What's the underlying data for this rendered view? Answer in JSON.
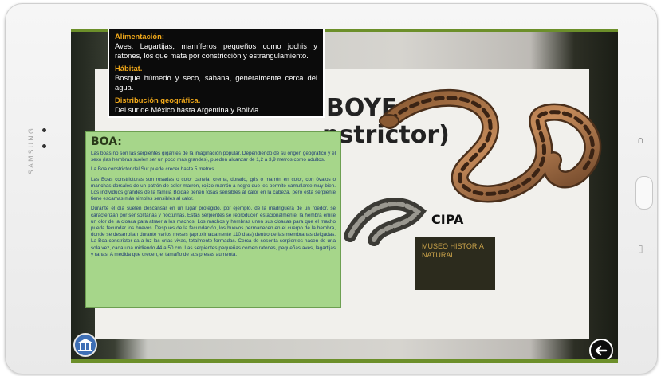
{
  "device": {
    "brand": "SAMSUNG"
  },
  "info_top": {
    "alimentacion_heading": "Alimentación:",
    "alimentacion_text": "Aves, Lagartijas, mamíferos pequeños como jochis y ratones, los que mata por constricción y estrangulamiento.",
    "habitat_heading": "Hábitat.",
    "habitat_text": "Bosque húmedo y seco, sabana, generalmente cerca del agua.",
    "distribucion_heading": "Distribución geográfica.",
    "distribucion_text": "Del sur de México hasta Argentina y Bolivia."
  },
  "boa_panel": {
    "title": "BOA:",
    "paragraphs": [
      "Las boas no son las serpientes gigantes de la imaginación popular. Dependiendo de su origen geográfico y el sexo (las hembras suelen ser un poco más grandes), pueden alcanzar de 1,2 a 3,9 metros como adultos.",
      "La Boa constrictor del Sur puede crecer hasta 5 metros.",
      "Las Boas constrictoras son rosadas o color canela, crema, dorado, gris o marrón en color, con óvalos o manchas dorsales de un patrón de color marrón, rojizo-marrón a negro que les permite camuflarse muy bien. Los individuos grandes de la familia Boidae tienen fosas sensibles al calor en la cabeza, pero esta serpiente tiene escamas más simples sensibles al calor.",
      "Durante el día suelen descansar en un lugar protegido, por ejemplo, de la madriguera de un roedor, se caracterizan por ser solitarias y nocturnas. Estas serpientes se reproducen estacionalmente; la hembra emite un olor de la cloaca para atraer a los machos. Los machos y hembras unen sus cloacas para que el macho pueda fecundar los huevos. Después de la fecundación, los huevos permanecen en el cuerpo de la hembra, donde se desarrollan durante varios meses (aproximadamente 110 días) dentro de las membranas delgadas. La Boa constrictor da a luz las crías vivas, totalmente formadas. Cerca de sesenta serpientes nacen de una sola vez, cada una midiendo 44 a 50 cm. Las serpientes pequeñas comen ratones, pequeñas aves, lagartijas y ranas. A medida que crecen, el tamaño de sus presas aumenta."
    ]
  },
  "poster": {
    "title_fragment": "BOYE",
    "subtitle_fragment": "nstrictor)",
    "logo_text": "CIPA",
    "museum_text": "MUSEO HISTORIA NATURAL"
  },
  "icons": {
    "museum": "museum-icon",
    "back": "back-arrow-icon"
  },
  "colors": {
    "panel_green": "#a6d68a",
    "heading_orange": "#f0a81a",
    "frame_green": "#6c8f2a"
  }
}
